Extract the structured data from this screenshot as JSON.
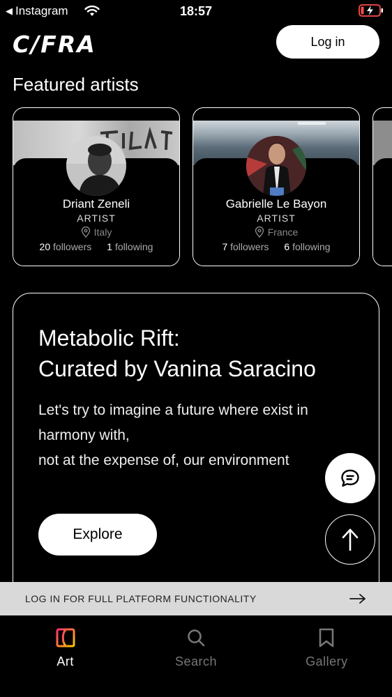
{
  "status_bar": {
    "back_app": "Instagram",
    "time": "18:57"
  },
  "header": {
    "logo": "C/FRA",
    "login_label": "Log in"
  },
  "featured": {
    "title": "Featured artists",
    "artists": [
      {
        "name": "Driant Zeneli",
        "role": "ARTIST",
        "location": "Italy",
        "followers": "20",
        "followers_label": "followers",
        "following": "1",
        "following_label": "following"
      },
      {
        "name": "Gabrielle Le Bayon",
        "role": "ARTIST",
        "location": "France",
        "followers": "7",
        "followers_label": "followers",
        "following": "6",
        "following_label": "following"
      }
    ]
  },
  "feature": {
    "title_line1": "Metabolic Rift:",
    "title_line2": "Curated by Vanina Saracino",
    "desc_line1": "Let's try to imagine a future where exist in",
    "desc_line2": "harmony with,",
    "desc_line3": "not at the expense of, our environment",
    "explore_label": "Explore"
  },
  "banner": {
    "text": "LOG IN FOR FULL PLATFORM FUNCTIONALITY"
  },
  "bottom_nav": {
    "items": [
      {
        "label": "Art",
        "icon": "art-icon"
      },
      {
        "label": "Search",
        "icon": "search-icon"
      },
      {
        "label": "Gallery",
        "icon": "bookmark-icon"
      }
    ]
  },
  "colors": {
    "background": "#000000",
    "foreground": "#ffffff",
    "banner_bg": "#d9d9d9",
    "inactive_nav": "#777777",
    "art_icon_gradient": [
      "#ff2f6d",
      "#ffc400"
    ]
  }
}
